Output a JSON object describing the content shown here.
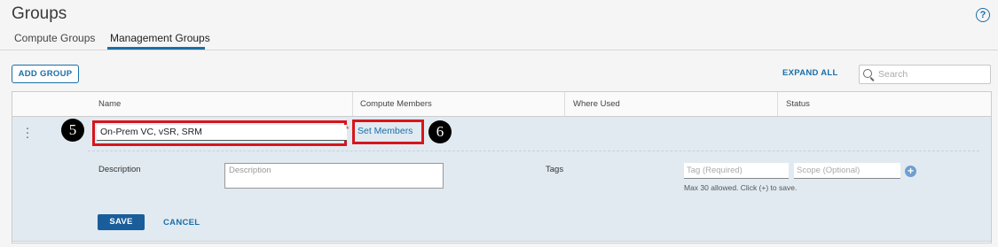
{
  "page": {
    "title": "Groups",
    "help_icon": "question-circle-icon",
    "help_glyph": "?"
  },
  "tabs": [
    {
      "label": "Compute Groups"
    },
    {
      "label": "Management Groups",
      "active": true
    }
  ],
  "toolbar": {
    "add_group": "ADD GROUP",
    "expand_all": "EXPAND ALL",
    "search_placeholder": "Search"
  },
  "table": {
    "columns": [
      "Name",
      "Compute Members",
      "Where Used",
      "Status"
    ]
  },
  "row": {
    "name_value": "On-Prem VC, vSR, SRM",
    "set_members": "Set Members",
    "required_mark": "*",
    "description_label": "Description",
    "description_placeholder": "Description",
    "tags_label": "Tags",
    "tag_placeholder": "Tag (Required)",
    "scope_placeholder": "Scope (Optional)",
    "tags_hint": "Max 30 allowed. Click (+) to save.",
    "save": "SAVE",
    "cancel": "CANCEL"
  },
  "markers": [
    "5",
    "6"
  ],
  "colors": {
    "accent": "#1a6fa8",
    "highlight": "#d6161c",
    "row_bg": "#e1eaf1"
  }
}
